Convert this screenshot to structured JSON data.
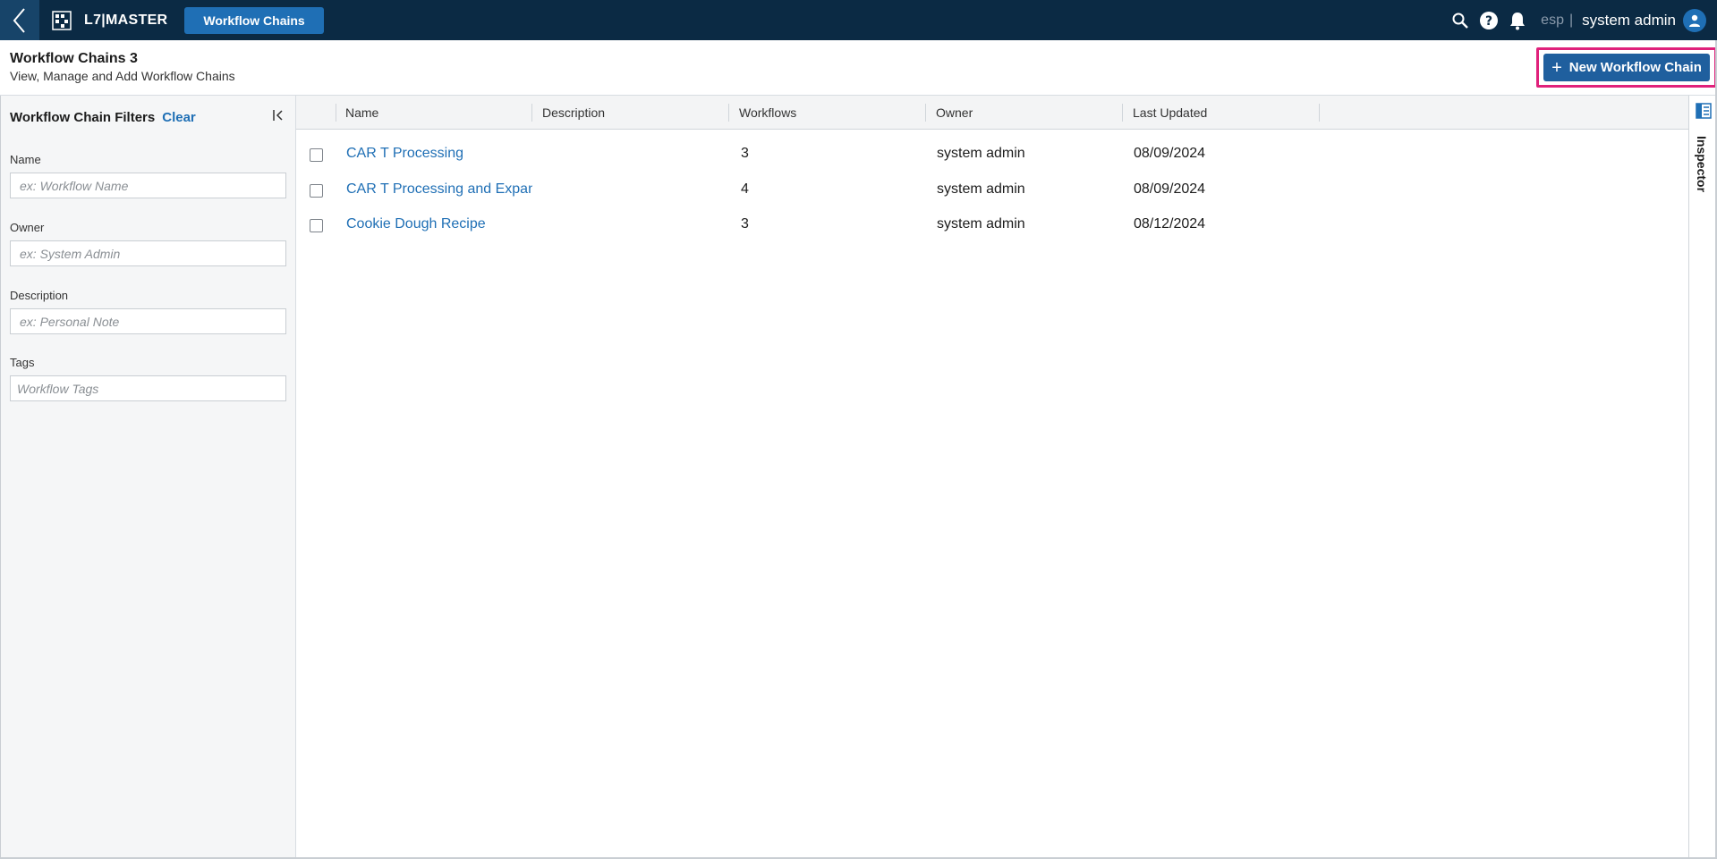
{
  "topbar": {
    "app_name": "L7|MASTER",
    "active_tab": "Workflow Chains",
    "lang": "esp",
    "lang_sep": "|",
    "user_name": "system admin",
    "accent": "#1f6fb5",
    "bg": "#0b2a44"
  },
  "header": {
    "title": "Workflow Chains 3",
    "subtitle": "View, Manage and Add Workflow Chains",
    "new_button": "New Workflow Chain",
    "highlight_color": "#e0217b"
  },
  "filters": {
    "title": "Workflow Chain Filters",
    "clear": "Clear",
    "fields": [
      {
        "label": "Name",
        "placeholder": "ex: Workflow Name"
      },
      {
        "label": "Owner",
        "placeholder": "ex: System Admin"
      },
      {
        "label": "Description",
        "placeholder": "ex: Personal Note"
      },
      {
        "label": "Tags",
        "placeholder": "Workflow Tags"
      }
    ]
  },
  "table": {
    "columns": [
      "Name",
      "Description",
      "Workflows",
      "Owner",
      "Last Updated"
    ],
    "rows": [
      {
        "name": "CAR T Processing",
        "description": "",
        "workflows": "3",
        "owner": "system admin",
        "last_updated": "08/09/2024"
      },
      {
        "name": "CAR T Processing and Expansion",
        "description": "",
        "workflows": "4",
        "owner": "system admin",
        "last_updated": "08/09/2024"
      },
      {
        "name": "Cookie Dough Recipe",
        "description": "",
        "workflows": "3",
        "owner": "system admin",
        "last_updated": "08/12/2024"
      }
    ]
  },
  "inspector": {
    "label": "Inspector",
    "icon": "inspector-panel-icon"
  }
}
